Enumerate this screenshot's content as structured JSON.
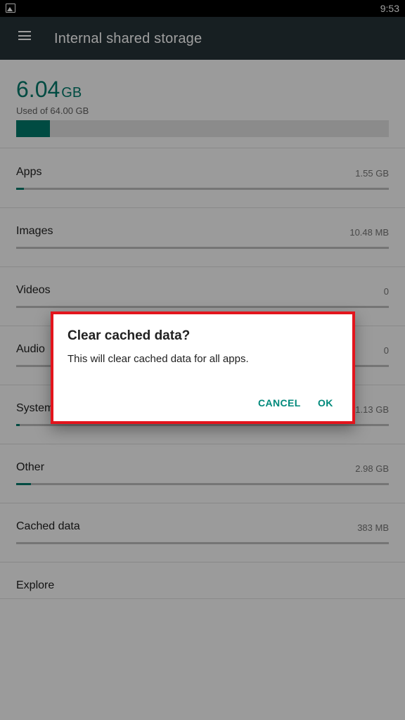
{
  "status_bar": {
    "time": "9:53"
  },
  "app_bar": {
    "title": "Internal shared storage"
  },
  "summary": {
    "used_value": "6.04",
    "used_unit": "GB",
    "used_of": "Used of 64.00 GB",
    "fraction": 0.09
  },
  "categories": [
    {
      "label": "Apps",
      "size": "1.55 GB",
      "fraction": 0.02
    },
    {
      "label": "Images",
      "size": "10.48 MB",
      "fraction": 0.0
    },
    {
      "label": "Videos",
      "size": "0",
      "fraction": 0.0
    },
    {
      "label": "Audio",
      "size": "0",
      "fraction": 0.0
    },
    {
      "label": "System",
      "size": "1.13 GB",
      "fraction": 0.01
    },
    {
      "label": "Other",
      "size": "2.98 GB",
      "fraction": 0.04
    },
    {
      "label": "Cached data",
      "size": "383 MB",
      "fraction": 0.0
    }
  ],
  "explore": {
    "label": "Explore"
  },
  "dialog": {
    "title": "Clear cached data?",
    "message": "This will clear cached data for all apps.",
    "cancel_label": "CANCEL",
    "ok_label": "OK"
  },
  "colors": {
    "accent": "#00796b",
    "appbar": "#263238",
    "highlight_border": "#e3151d"
  }
}
